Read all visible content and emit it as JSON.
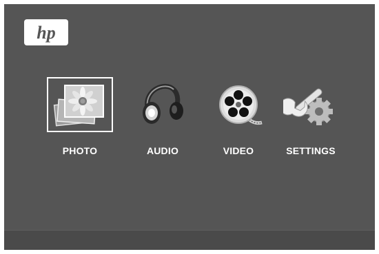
{
  "brand": {
    "logo_text": "hp",
    "logo_icon": "hp-logo"
  },
  "menu": {
    "selected_index": 0,
    "items": [
      {
        "label": "PHOTO",
        "icon": "photo-icon"
      },
      {
        "label": "AUDIO",
        "icon": "headphones-icon"
      },
      {
        "label": "VIDEO",
        "icon": "film-reel-icon"
      },
      {
        "label": "SETTINGS",
        "icon": "wrench-gear-icon"
      }
    ]
  },
  "colors": {
    "background": "#555555",
    "footer": "#4a4a4a",
    "text": "#ffffff",
    "selection_border": "#ffffff"
  }
}
